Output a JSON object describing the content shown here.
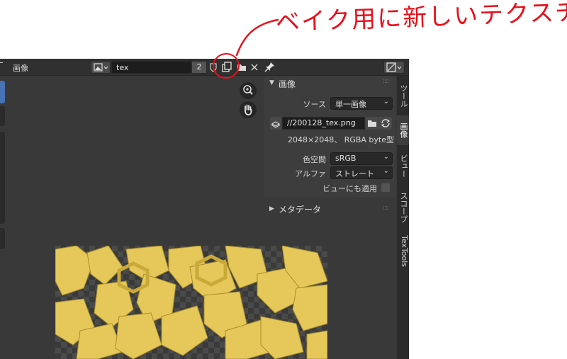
{
  "annotation": {
    "text": "ベイク用に新しいテクスチャ作る"
  },
  "header": {
    "image_menu": "画像",
    "image_name": "tex",
    "users_count": "2"
  },
  "sidebar": {
    "image_panel": {
      "title": "画像",
      "source_label": "ソース",
      "source_value": "単一画像",
      "filepath": "//200128_tex.png",
      "image_info": "2048×2048、 RGBA byte型",
      "colorspace_label": "色空間",
      "colorspace_value": "sRGB",
      "alpha_label": "アルファ",
      "alpha_value": "ストレート",
      "view_as_render_label": "ビューにも適用"
    },
    "metadata_panel": {
      "title": "メタデータ"
    }
  },
  "tabs": [
    "ツール",
    "画像",
    "ビュー",
    "スコープ",
    "TexTools"
  ],
  "colors": {
    "annotation": "#e8101a",
    "editor_bg": "#393939",
    "texture_fill": "#e6c85a"
  },
  "icons": {
    "image_type": "image-icon",
    "fake_user": "shield-icon",
    "new_image": "duplicate-icon",
    "open_image": "folder-icon",
    "close": "close-icon",
    "pin": "pin-icon",
    "zoom": "zoom-icon",
    "pan": "hand-icon"
  }
}
